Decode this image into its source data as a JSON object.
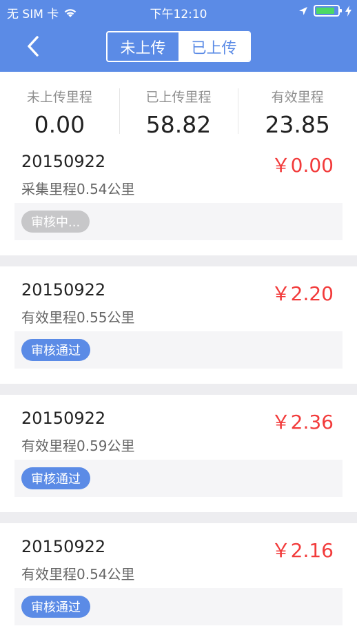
{
  "status_bar": {
    "carrier": "无 SIM 卡",
    "time": "下午12:10",
    "icons": [
      "wifi-icon",
      "location-icon",
      "battery-icon",
      "charging-icon"
    ]
  },
  "header": {
    "back_icon": "chevron-left-icon",
    "tabs": [
      {
        "label": "未上传",
        "active": false
      },
      {
        "label": "已上传",
        "active": true
      }
    ]
  },
  "summary": [
    {
      "label": "未上传里程",
      "value": "0.00"
    },
    {
      "label": "已上传里程",
      "value": "58.82"
    },
    {
      "label": "有效里程",
      "value": "23.85"
    }
  ],
  "records": [
    {
      "date": "20150922",
      "desc": "采集里程0.54公里",
      "amount": "￥0.00",
      "status": "审核中...",
      "status_color": "#c7c7c9"
    },
    {
      "date": "20150922",
      "desc": "有效里程0.55公里",
      "amount": "￥2.20",
      "status": "审核通过",
      "status_color": "#5b8be6"
    },
    {
      "date": "20150922",
      "desc": "有效里程0.59公里",
      "amount": "￥2.36",
      "status": "审核通过",
      "status_color": "#5b8be6"
    },
    {
      "date": "20150922",
      "desc": "有效里程0.54公里",
      "amount": "￥2.16",
      "status": "审核通过",
      "status_color": "#5b8be6"
    }
  ],
  "colors": {
    "accent": "#5b8be6",
    "amount": "#f23b3b",
    "battery": "#4cd964"
  }
}
